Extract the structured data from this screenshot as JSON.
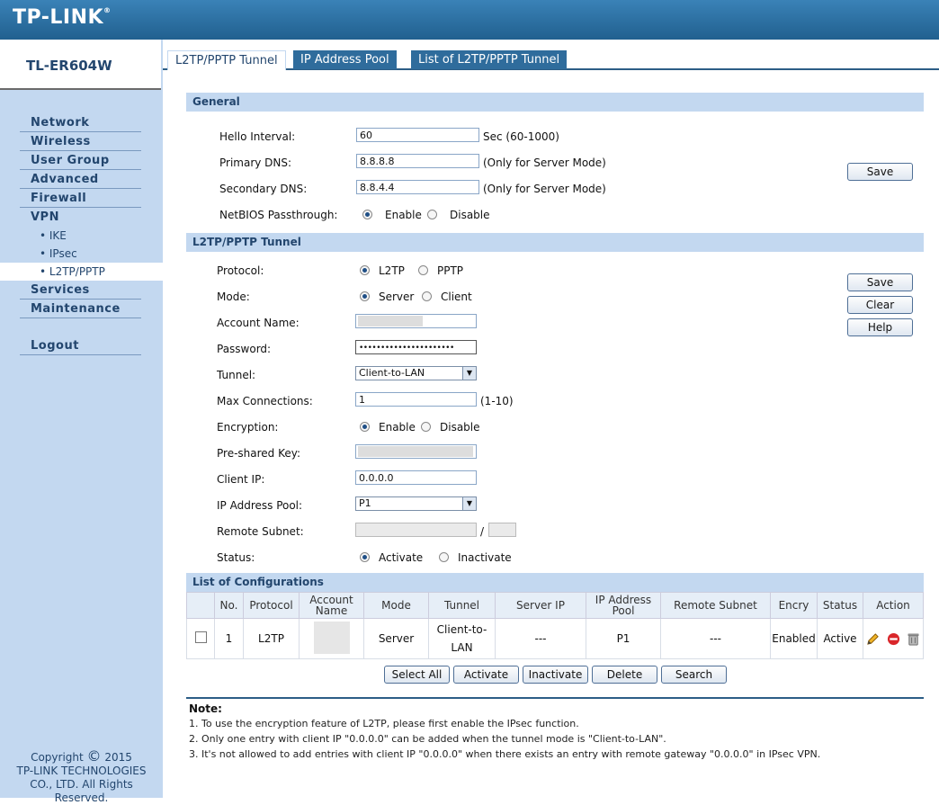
{
  "brand": {
    "logo": "TP-LINK",
    "model": "TL-ER604W"
  },
  "sidebar": {
    "items": [
      {
        "label": "Network"
      },
      {
        "label": "Wireless"
      },
      {
        "label": "User Group"
      },
      {
        "label": "Advanced"
      },
      {
        "label": "Firewall"
      },
      {
        "label": "VPN"
      },
      {
        "label": "Services"
      },
      {
        "label": "Maintenance"
      },
      {
        "label": "Logout"
      }
    ],
    "vpn_sub": [
      {
        "label": "• IKE"
      },
      {
        "label": "• IPsec"
      },
      {
        "label": "• L2TP/PPTP"
      }
    ],
    "copyright_line1": "Copyright",
    "copyright_year": "2015",
    "copyright_line2": "TP-LINK TECHNOLOGIES",
    "copyright_line3": "CO., LTD. All Rights",
    "copyright_line4": "Reserved."
  },
  "tabs": [
    {
      "label": "L2TP/PPTP Tunnel"
    },
    {
      "label": "IP Address Pool"
    },
    {
      "label": "List of L2TP/PPTP Tunnel"
    }
  ],
  "general": {
    "title": "General",
    "hello_label": "Hello Interval:",
    "hello_value": "60",
    "hello_hint": "Sec (60-1000)",
    "pdns_label": "Primary DNS:",
    "pdns_value": "8.8.8.8",
    "pdns_hint": "(Only for Server Mode)",
    "sdns_label": "Secondary DNS:",
    "sdns_value": "8.8.4.4",
    "sdns_hint": "(Only for Server Mode)",
    "netbios_label": "NetBIOS Passthrough:",
    "enable": "Enable",
    "disable": "Disable",
    "save": "Save"
  },
  "tunnel": {
    "title": "L2TP/PPTP Tunnel",
    "protocol_label": "Protocol:",
    "protocol_opt1": "L2TP",
    "protocol_opt2": "PPTP",
    "mode_label": "Mode:",
    "mode_opt1": "Server",
    "mode_opt2": "Client",
    "account_label": "Account Name:",
    "password_label": "Password:",
    "password_value": "••••••••••••••••••••••",
    "tunnel_label": "Tunnel:",
    "tunnel_value": "Client-to-LAN",
    "maxconn_label": "Max Connections:",
    "maxconn_value": "1",
    "maxconn_hint": "(1-10)",
    "enc_label": "Encryption:",
    "enc_opt1": "Enable",
    "enc_opt2": "Disable",
    "psk_label": "Pre-shared Key:",
    "clientip_label": "Client IP:",
    "clientip_value": "0.0.0.0",
    "pool_label": "IP Address Pool:",
    "pool_value": "P1",
    "subnet_label": "Remote Subnet:",
    "subnet_sep": "/",
    "status_label": "Status:",
    "status_opt1": "Activate",
    "status_opt2": "Inactivate",
    "save": "Save",
    "clear": "Clear",
    "help": "Help"
  },
  "list": {
    "title": "List of Configurations",
    "headers": [
      "No.",
      "Protocol",
      "Account Name",
      "Mode",
      "Tunnel",
      "Server IP",
      "IP Address Pool",
      "Remote Subnet",
      "Encry",
      "Status",
      "Action"
    ],
    "rows": [
      {
        "no": "1",
        "protocol": "L2TP",
        "mode": "Server",
        "tunnel": "Client-to-LAN",
        "server_ip": "---",
        "pool": "P1",
        "subnet": "---",
        "encry": "Enabled",
        "status": "Active"
      }
    ],
    "buttons": {
      "select_all": "Select All",
      "activate": "Activate",
      "inactivate": "Inactivate",
      "delete": "Delete",
      "search": "Search"
    }
  },
  "note": {
    "title": "Note:",
    "line1": "1. To use the encryption feature of L2TP, please first enable the IPsec function.",
    "line2": "2. Only one entry with client IP \"0.0.0.0\" can be added when the tunnel mode is \"Client-to-LAN\".",
    "line3": "3. It's not allowed to add entries with client IP \"0.0.0.0\" when there exists an entry with remote gateway \"0.0.0.0\" in IPsec VPN."
  },
  "colors": {
    "header": "#2c6ea0",
    "sidebar": "#c3d8f0",
    "section": "#c3d8f0",
    "text_blue": "#23466e"
  }
}
